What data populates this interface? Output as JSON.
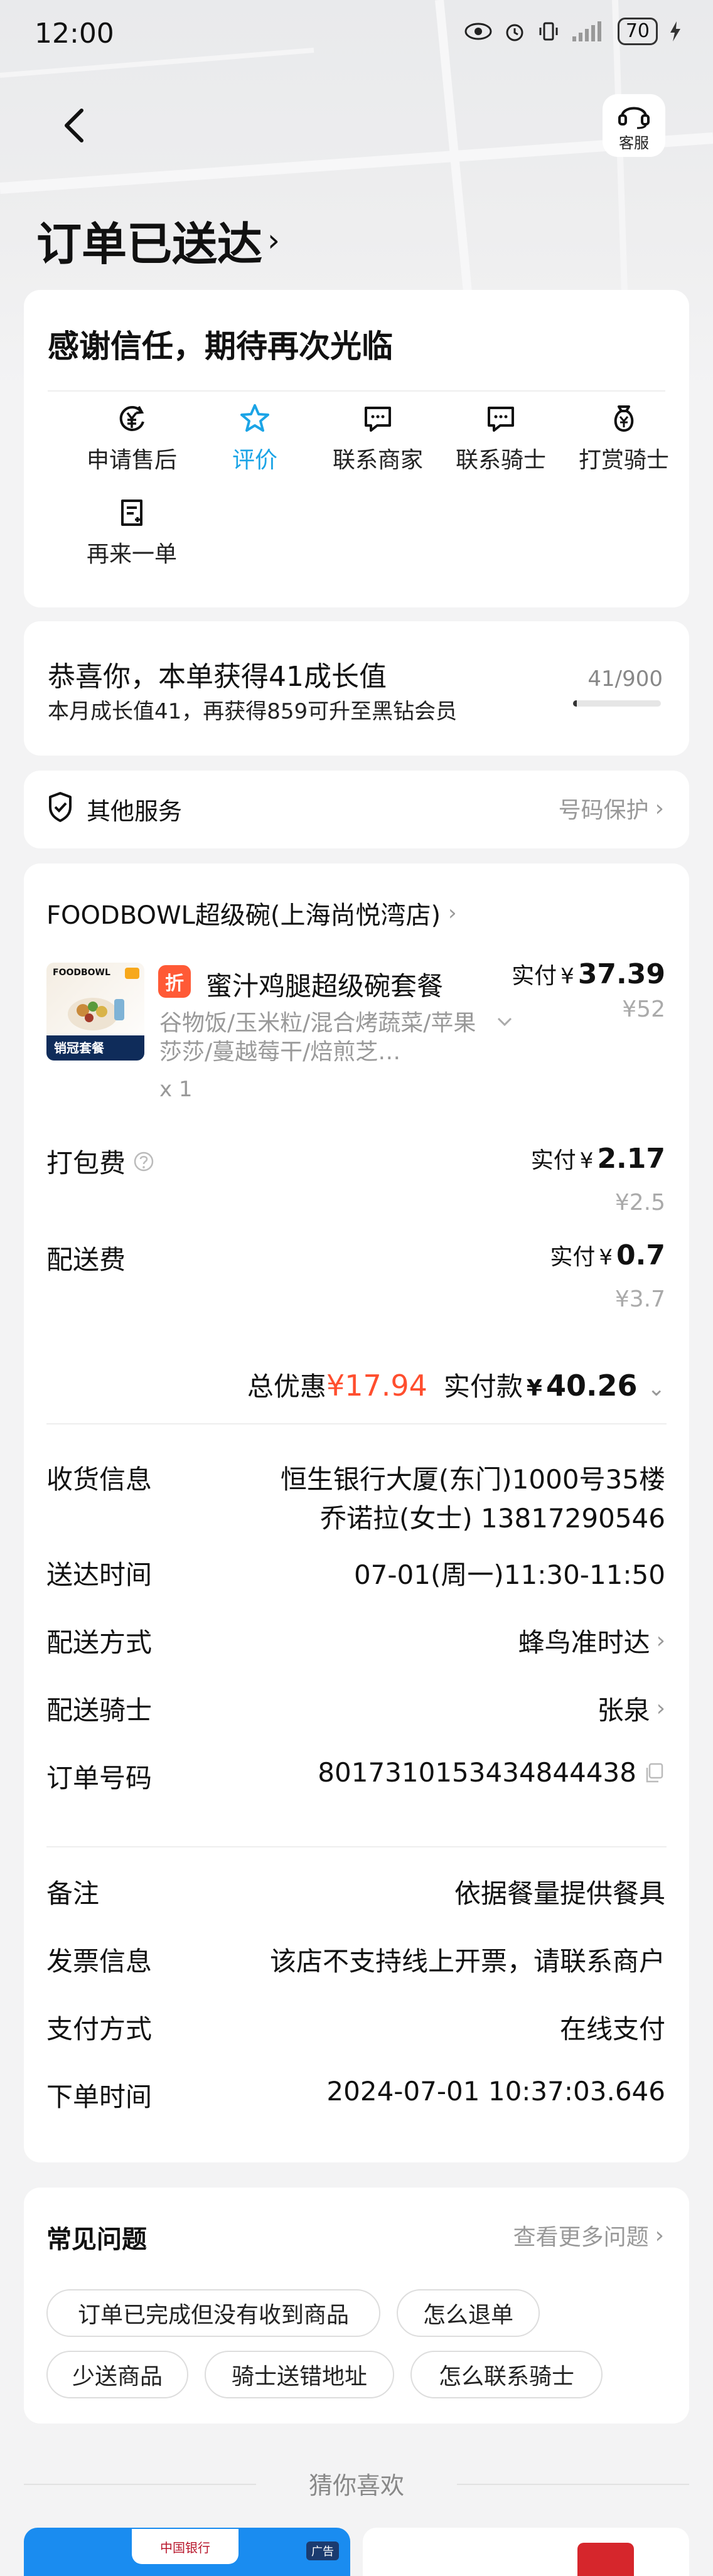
{
  "status_bar": {
    "time": "12:00",
    "battery": "70"
  },
  "header": {
    "service_label": "客服",
    "order_status": "订单已送达"
  },
  "thanks_card": {
    "title": "感谢信任，期待再次光临",
    "actions": [
      {
        "label": "申请售后",
        "icon": "yuan-refund-icon"
      },
      {
        "label": "评价",
        "icon": "star-icon",
        "active": true
      },
      {
        "label": "联系商家",
        "icon": "chat-icon"
      },
      {
        "label": "联系骑士",
        "icon": "chat-icon"
      },
      {
        "label": "打赏骑士",
        "icon": "reward-bag-icon"
      },
      {
        "label": "再来一单",
        "icon": "reorder-doc-icon"
      }
    ]
  },
  "growth": {
    "title": "恭喜你，本单获得41成长值",
    "subtitle": "本月成长值41，再获得859可升至黑钻会员",
    "count": "41/900",
    "progress_fraction": 0.0456
  },
  "other_services": {
    "label": "其他服务",
    "right": "号码保护"
  },
  "order": {
    "store_name": "FOODBOWL超级碗(上海尚悦湾店)",
    "product": {
      "image_brand": "FOODBOWL",
      "image_ribbon": "销冠套餐",
      "badge": "折",
      "name": "蜜汁鸡腿超级碗套餐",
      "desc": "谷物饭/玉米粒/混合烤蔬菜/苹果莎莎/蔓越莓干/焙煎芝…",
      "qty": "x 1",
      "pay_label": "实付",
      "currency": "¥",
      "pay": "37.39",
      "original": "¥52"
    },
    "packing_fee": {
      "label": "打包费",
      "pay_label": "实付",
      "currency": "¥",
      "pay": "2.17",
      "original": "¥2.5"
    },
    "delivery_fee": {
      "label": "配送费",
      "pay_label": "实付",
      "currency": "¥",
      "pay": "0.7",
      "original": "¥3.7"
    },
    "total": {
      "discount_label": "总优惠",
      "discount_value": "¥17.94",
      "paid_label": "实付款",
      "currency": "¥",
      "paid_value": "40.26"
    },
    "info": {
      "address_label": "收货信息",
      "address_line1": "恒生银行大厦(东门)1000号35楼",
      "address_line2": "乔诺拉(女士) 13817290546",
      "time_label": "送达时间",
      "time_value": "07-01(周一)11:30-11:50",
      "method_label": "配送方式",
      "method_value": "蜂鸟准时达",
      "rider_label": "配送骑士",
      "rider_value": "张泉",
      "order_no_label": "订单号码",
      "order_no_value": "8017310153434844438",
      "note_label": "备注",
      "note_value": "依据餐量提供餐具",
      "invoice_label": "发票信息",
      "invoice_value": "该店不支持线上开票，请联系商户",
      "payment_label": "支付方式",
      "payment_value": "在线支付",
      "order_time_label": "下单时间",
      "order_time_value": "2024-07-01 10:37:03.646"
    }
  },
  "faq": {
    "title": "常见问题",
    "more": "查看更多问题",
    "chips": [
      "订单已完成但没有收到商品",
      "怎么退单",
      "少送商品",
      "骑士送错地址",
      "怎么联系骑士"
    ]
  },
  "recommend": {
    "title": "猜你喜欢",
    "ad_tag": "广告",
    "ad_brand": "中国银行"
  },
  "colors": {
    "accent": "#1ba4e6",
    "discount": "#ff4e2e",
    "badge": "#ff5a36"
  }
}
